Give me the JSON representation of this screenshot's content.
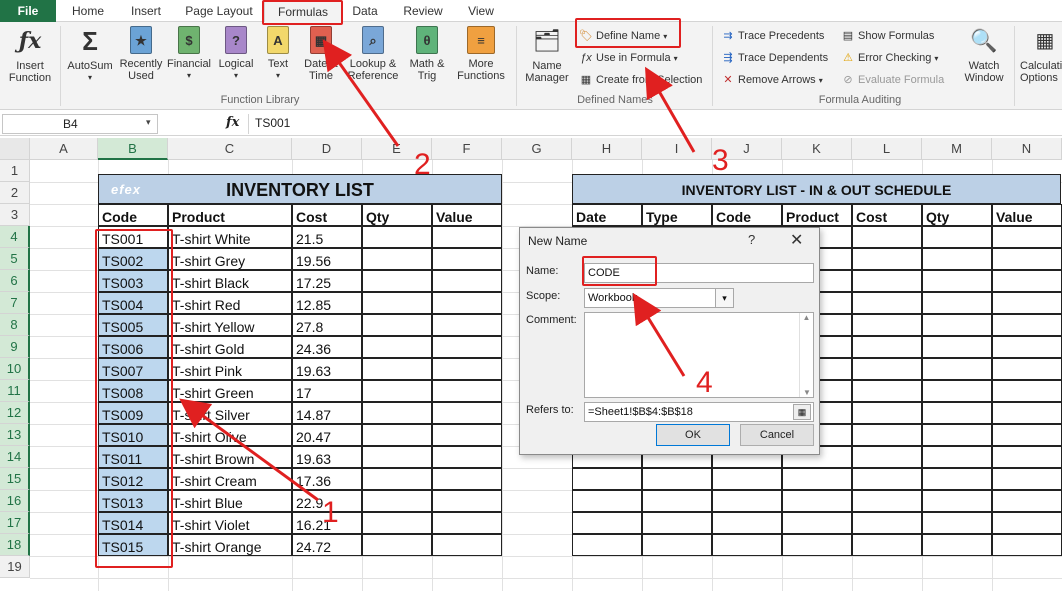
{
  "tabs": [
    "File",
    "Home",
    "Insert",
    "Page Layout",
    "Formulas",
    "Data",
    "Review",
    "View"
  ],
  "ribbon": {
    "insert_function": "Insert\nFunction",
    "autosum": "AutoSum",
    "recently_used": "Recently\nUsed",
    "financial": "Financial",
    "logical": "Logical",
    "text": "Text",
    "date_time": "Date &\nTime",
    "lookup_reference": "Lookup &\nReference",
    "math_trig": "Math &\nTrig",
    "more_functions": "More\nFunctions",
    "function_library_label": "Function Library",
    "name_manager": "Name\nManager",
    "define_name": "Define Name",
    "use_in_formula": "Use in Formula",
    "create_from_selection": "Create from Selection",
    "defined_names_label": "Defined Names",
    "trace_precedents": "Trace Precedents",
    "trace_dependents": "Trace Dependents",
    "remove_arrows": "Remove Arrows",
    "show_formulas": "Show Formulas",
    "error_checking": "Error Checking",
    "evaluate_formula": "Evaluate Formula",
    "formula_auditing_label": "Formula Auditing",
    "watch_window": "Watch\nWindow",
    "calculation_options": "Calculation\nOptions"
  },
  "formula_bar": {
    "name_box": "B4",
    "fx": "fx",
    "content": "TS001"
  },
  "columns": [
    "A",
    "B",
    "C",
    "D",
    "E",
    "F",
    "G",
    "H",
    "I",
    "J",
    "K",
    "L",
    "M",
    "N"
  ],
  "rows": [
    "1",
    "2",
    "3",
    "4",
    "5",
    "6",
    "7",
    "8",
    "9",
    "10",
    "11",
    "12",
    "13",
    "14",
    "15",
    "16",
    "17",
    "18",
    "19"
  ],
  "inventory": {
    "title": "INVENTORY LIST",
    "headers": [
      "Code",
      "Product",
      "Cost",
      "Qty",
      "Value"
    ],
    "items": [
      {
        "code": "TS001",
        "product": "T-shirt White",
        "cost": "21.5"
      },
      {
        "code": "TS002",
        "product": "T-shirt Grey",
        "cost": "19.56"
      },
      {
        "code": "TS003",
        "product": "T-shirt Black",
        "cost": "17.25"
      },
      {
        "code": "TS004",
        "product": "T-shirt Red",
        "cost": "12.85"
      },
      {
        "code": "TS005",
        "product": "T-shirt Yellow",
        "cost": "27.8"
      },
      {
        "code": "TS006",
        "product": "T-shirt Gold",
        "cost": "24.36"
      },
      {
        "code": "TS007",
        "product": "T-shirt Pink",
        "cost": "19.63"
      },
      {
        "code": "TS008",
        "product": "T-shirt Green",
        "cost": "17"
      },
      {
        "code": "TS009",
        "product": "T-shirt Silver",
        "cost": "14.87"
      },
      {
        "code": "TS010",
        "product": "T-shirt Olive",
        "cost": "20.47"
      },
      {
        "code": "TS011",
        "product": "T-shirt Brown",
        "cost": "19.63"
      },
      {
        "code": "TS012",
        "product": "T-shirt Cream",
        "cost": "17.36"
      },
      {
        "code": "TS013",
        "product": "T-shirt Blue",
        "cost": "22.9"
      },
      {
        "code": "TS014",
        "product": "T-shirt Violet",
        "cost": "16.21"
      },
      {
        "code": "TS015",
        "product": "T-shirt Orange",
        "cost": "24.72"
      }
    ]
  },
  "schedule": {
    "title": "INVENTORY LIST - IN & OUT SCHEDULE",
    "headers": [
      "Date",
      "Type",
      "Code",
      "Product",
      "Cost",
      "Qty",
      "Value"
    ]
  },
  "dialog": {
    "title": "New Name",
    "help": "?",
    "close": "✕",
    "name_label": "Name:",
    "name_value": "CODE",
    "scope_label": "Scope:",
    "scope_value": "Workbook",
    "comment_label": "Comment:",
    "refers_label": "Refers to:",
    "refers_value": "=Sheet1!$B$4:$B$18",
    "ok": "OK",
    "cancel": "Cancel"
  },
  "annotations": [
    "1",
    "2",
    "3",
    "4"
  ],
  "logo_text": "efex",
  "colors": {
    "excel_green": "#217346",
    "annotation_red": "#e02020",
    "banner_blue": "#bcd0e6",
    "selection_blue": "#bdd7ee"
  }
}
